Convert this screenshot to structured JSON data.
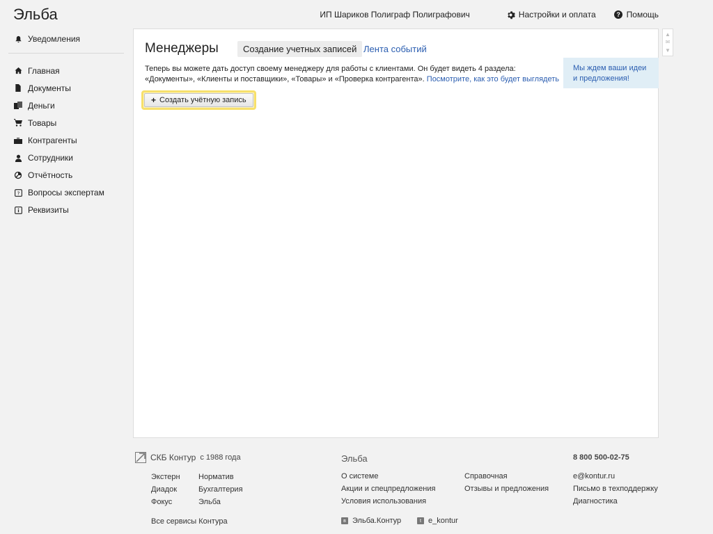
{
  "app": {
    "title": "Эльба"
  },
  "header": {
    "user_name": "ИП Шариков Полиграф Полиграфович",
    "settings_label": "Настройки и оплата",
    "help_label": "Помощь"
  },
  "sidebar": {
    "notifications_label": "Уведомления",
    "items": [
      {
        "label": "Главная",
        "icon": "home-icon"
      },
      {
        "label": "Документы",
        "icon": "document-icon"
      },
      {
        "label": "Деньги",
        "icon": "money-icon"
      },
      {
        "label": "Товары",
        "icon": "cart-icon"
      },
      {
        "label": "Контрагенты",
        "icon": "briefcase-icon"
      },
      {
        "label": "Сотрудники",
        "icon": "person-icon"
      },
      {
        "label": "Отчётность",
        "icon": "report-icon"
      },
      {
        "label": "Вопросы экспертам",
        "icon": "question-icon"
      },
      {
        "label": "Реквизиты",
        "icon": "info-icon"
      }
    ]
  },
  "main": {
    "title": "Менеджеры",
    "tab_active": "Создание учетных записей",
    "tab_events": "Лента событий",
    "description": "Теперь вы можете дать доступ своему менеджеру для работы с клиентами. Он будет видеть 4 раздела: «Документы», «Клиенты и поставщики», «Товары» и «Проверка контрагента».",
    "description_link": "Посмотрите, как это будет выглядеть",
    "create_button": "Создать учётную запись",
    "feedback_text": "Мы ждем ваши идеи и предложения!"
  },
  "footer": {
    "brand_name": "СКБ Контур",
    "brand_year": "с 1988 года",
    "services": [
      "Экстерн",
      "Норматив",
      "Диадок",
      "Бухгалтерия",
      "Фокус",
      "Эльба"
    ],
    "all_services": "Все сервисы Контура",
    "elba_heading": "Эльба",
    "elba_links": [
      "О системе",
      "Акции и спецпредложения",
      "Условия использования"
    ],
    "more_links": [
      "Справочная",
      "Отзывы и предложения"
    ],
    "phone": "8 800 500-02-75",
    "contact_links": [
      "e@kontur.ru",
      "Письмо в техподдержку",
      "Диагностика"
    ],
    "social_1": "Эльба.Контур",
    "social_2": "e_kontur"
  },
  "colors": {
    "link": "#2a5db0",
    "highlight": "#f7e06b",
    "feedback_bg": "#e0eef6"
  }
}
